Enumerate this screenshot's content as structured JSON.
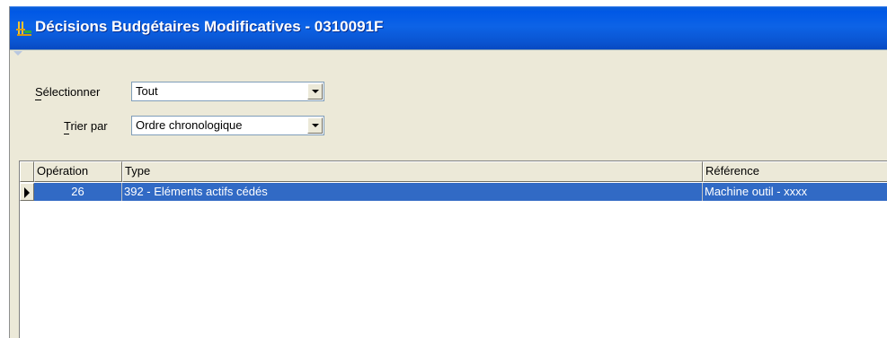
{
  "window": {
    "title": "Décisions Budgétaires Modificatives - 0310091F",
    "title_bar_color": "#0a55d2",
    "icon": "scales-icon"
  },
  "filters": {
    "select_label": "Sélectionner",
    "select_value": "Tout",
    "sort_label": "Trier par",
    "sort_value": "Ordre chronologique"
  },
  "grid": {
    "columns": [
      "Opération",
      "Type",
      "Référence"
    ],
    "rows": [
      {
        "operation": "26",
        "type": "392 - Eléments actifs cédés",
        "reference": "Machine outil  - xxxx",
        "selected": true
      }
    ],
    "selection_color": "#316ac5"
  }
}
